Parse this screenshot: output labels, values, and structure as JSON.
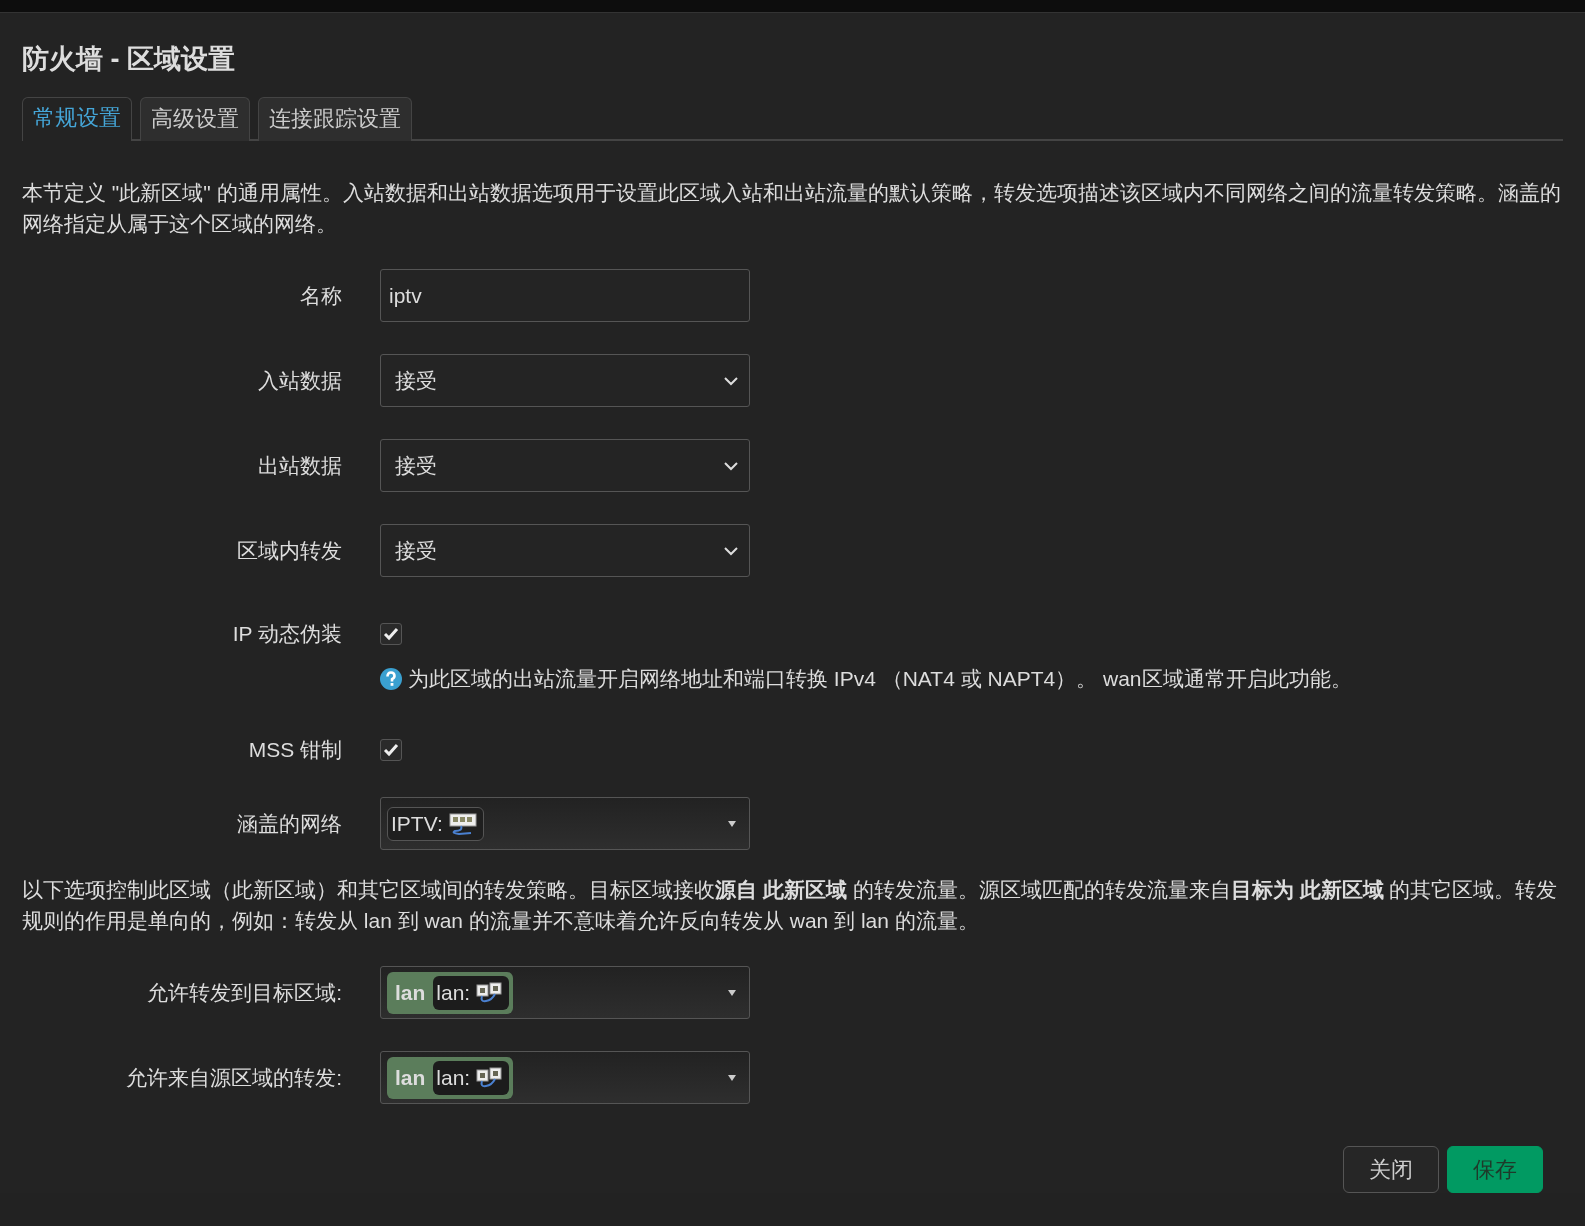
{
  "title": "防火墙 - 区域设置",
  "tabs": [
    {
      "label": "常规设置",
      "selected": true
    },
    {
      "label": "高级设置",
      "selected": false
    },
    {
      "label": "连接跟踪设置",
      "selected": false
    }
  ],
  "intro": "本节定义 \"此新区域\" 的通用属性。入站数据和出站数据选项用于设置此区域入站和出站流量的默认策略，转发选项描述该区域内不同网络之间的流量转发策略。涵盖的网络指定从属于这个区域的网络。",
  "fields": [
    {
      "kind": "text",
      "label": "名称",
      "value": "iptv"
    },
    {
      "kind": "select",
      "label": "入站数据",
      "value": "接受"
    },
    {
      "kind": "select",
      "label": "出站数据",
      "value": "接受"
    },
    {
      "kind": "select",
      "label": "区域内转发",
      "value": "接受"
    },
    {
      "kind": "checkbox",
      "label": "IP 动态伪装",
      "checked": true,
      "help": "为此区域的出站流量开启网络地址和端口转换 IPv4 （NAT4 或 NAPT4）。 wan区域通常开启此功能。"
    },
    {
      "kind": "checkbox",
      "label": "MSS 钳制",
      "checked": true
    },
    {
      "kind": "networks",
      "label": "涵盖的网络",
      "items": [
        {
          "name": "IPTV:"
        }
      ]
    }
  ],
  "forwarding_intro": "以下选项控制此区域（此新区域）和其它区域间的转发策略。目标区域接收**源自 此新区域** 的转发流量。源区域匹配的转发流量来自**目标为 此新区域** 的其它区域。转发规则的作用是单向的，例如：转发从 lan 到 wan 的流量并不意味着允许反向转发从 wan 到 lan 的流量。",
  "forwarding": [
    {
      "label": "允许转发到目标区域:",
      "zones": [
        {
          "zone": "lan",
          "network": "lan:",
          "color": "#5b7d5b"
        }
      ]
    },
    {
      "label": "允许来自源区域的转发:",
      "zones": [
        {
          "zone": "lan",
          "network": "lan:",
          "color": "#5b7d5b"
        }
      ]
    }
  ],
  "buttons": [
    {
      "label": "关闭",
      "kind": "secondary"
    },
    {
      "label": "保存",
      "kind": "primary"
    }
  ]
}
